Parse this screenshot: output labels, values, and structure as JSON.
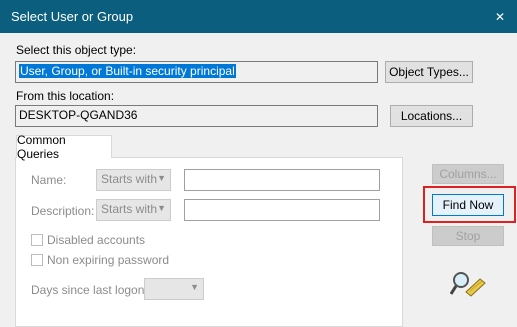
{
  "window": {
    "title": "Select User or Group",
    "close_glyph": "✕"
  },
  "object_type": {
    "label": "Select this object type:",
    "value": "User, Group, or Built-in security principal",
    "button": "Object Types..."
  },
  "location": {
    "label": "From this location:",
    "value": "DESKTOP-QGAND36",
    "button": "Locations..."
  },
  "tab": {
    "label": "Common Queries"
  },
  "queries": {
    "name_label": "Name:",
    "name_mode": "Starts with",
    "description_label": "Description:",
    "description_mode": "Starts with",
    "disabled_accounts": "Disabled accounts",
    "non_expiring_password": "Non expiring password",
    "days_label": "Days since last logon:",
    "days_value": ""
  },
  "actions": {
    "columns": "Columns...",
    "find_now": "Find Now",
    "stop": "Stop"
  },
  "colors": {
    "titlebar": "#0b5e7e",
    "selection": "#0078d7",
    "highlight": "#e02020"
  },
  "icons": {
    "close": "close-icon",
    "search": "search-icon"
  }
}
